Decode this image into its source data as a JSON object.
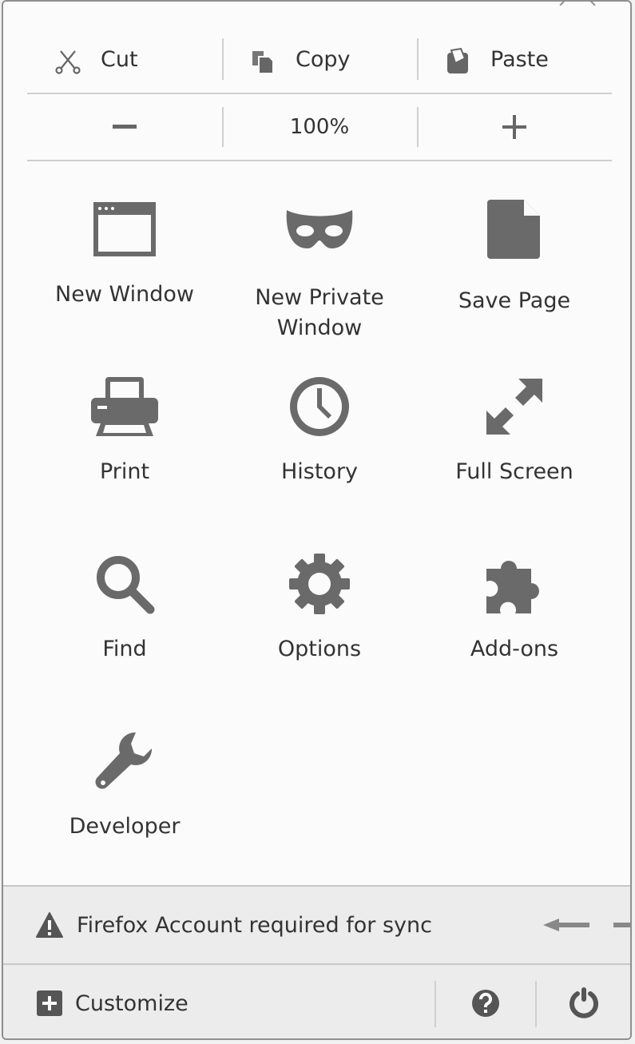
{
  "edit": {
    "cut_label": "Cut",
    "copy_label": "Copy",
    "paste_label": "Paste"
  },
  "zoom": {
    "out_label": "−",
    "level": "100%",
    "in_label": "+"
  },
  "tiles": [
    {
      "label": "New Window",
      "icon": "new-window-icon"
    },
    {
      "label": "New Private Window",
      "icon": "private-mask-icon"
    },
    {
      "label": "Save Page",
      "icon": "save-page-icon"
    },
    {
      "label": "Print",
      "icon": "printer-icon"
    },
    {
      "label": "History",
      "icon": "clock-icon"
    },
    {
      "label": "Full Screen",
      "icon": "fullscreen-arrows-icon"
    },
    {
      "label": "Find",
      "icon": "search-icon"
    },
    {
      "label": "Options",
      "icon": "gear-icon"
    },
    {
      "label": "Add-ons",
      "icon": "puzzle-icon"
    },
    {
      "label": "Developer",
      "icon": "wrench-icon"
    }
  ],
  "sync": {
    "message": "Firefox Account required for sync",
    "icon": "warning-icon"
  },
  "footer": {
    "customize_label": "Customize",
    "help_icon": "help-icon",
    "quit_icon": "power-icon"
  },
  "colors": {
    "icon_gray": "#6a6a6a",
    "panel_bg": "#fbfbfb",
    "footer_bg": "#ececec"
  }
}
